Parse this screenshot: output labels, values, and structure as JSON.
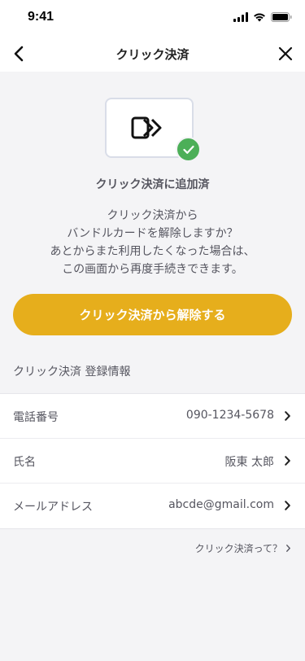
{
  "status_bar": {
    "time": "9:41"
  },
  "nav": {
    "title": "クリック決済"
  },
  "hero": {
    "added_title": "クリック決済に追加済",
    "description_lines": [
      "クリック決済から",
      "バンドルカードを解除しますか？",
      "あとからまた利用したくなった場合は、",
      "この画面から再度手続きできます。"
    ]
  },
  "primary_button": {
    "label": "クリック決済から解除する"
  },
  "registration": {
    "heading": "クリック決済 登録情報",
    "rows": [
      {
        "label": "電話番号",
        "value": "090-1234-5678"
      },
      {
        "label": "氏名",
        "value": "阪東 太郎"
      },
      {
        "label": "メールアドレス",
        "value": "abcde@gmail.com"
      }
    ]
  },
  "help_link": {
    "label": "クリック決済って？"
  },
  "colors": {
    "accent": "#e6ae1c",
    "success": "#4caf58",
    "background": "#f4f4f6",
    "text": "#55555f"
  }
}
